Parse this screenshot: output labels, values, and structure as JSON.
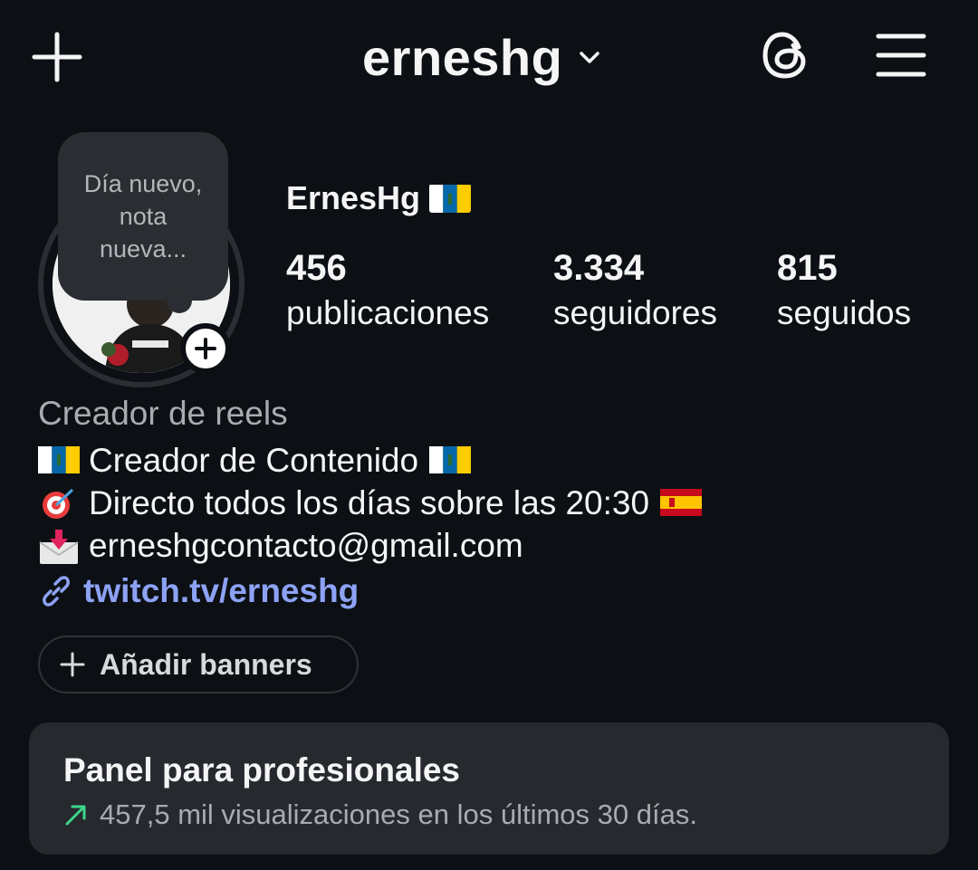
{
  "header": {
    "username": "erneshg"
  },
  "note": {
    "text": "Día nuevo, nota nueva..."
  },
  "profile": {
    "display_name": "ErnesHg",
    "stats": [
      {
        "value": "456",
        "label": "publicaciones"
      },
      {
        "value": "3.334",
        "label": "seguidores"
      },
      {
        "value": "815",
        "label": "seguidos"
      }
    ]
  },
  "bio": {
    "category": "Creador de reels",
    "lines": [
      "Creador de Contenido",
      "Directo todos los días sobre las 20:30",
      "erneshgcontacto@gmail.com"
    ],
    "link": "twitch.tv/erneshg"
  },
  "banner_button": {
    "label": "Añadir banners"
  },
  "pro_panel": {
    "title": "Panel para profesionales",
    "stats": "457,5 mil visualizaciones en los últimos 30 días."
  },
  "colors": {
    "background": "#0c1014",
    "link": "#8da2f5",
    "panel": "#262a2f",
    "trend_up": "#3dd68c"
  },
  "icons": {
    "add": "plus-icon",
    "chevron": "chevron-down-icon",
    "threads": "threads-icon",
    "menu": "hamburger-menu-icon",
    "link": "link-icon",
    "trend": "trend-up-arrow-icon"
  }
}
